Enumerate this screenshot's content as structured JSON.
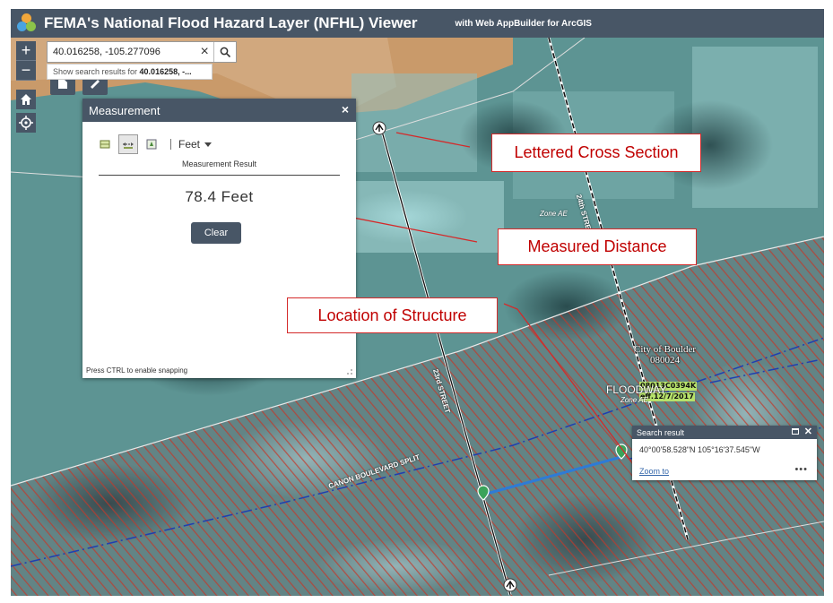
{
  "app": {
    "title": "FEMA's National Flood Hazard Layer (NFHL) Viewer",
    "subtitle": "with Web AppBuilder for ArcGIS"
  },
  "search": {
    "value": "40.016258, -105.277096",
    "suggestion_prefix": "Show search results for ",
    "suggestion_value": "40.016258, -..."
  },
  "map_controls": {
    "zoom_in": "+",
    "zoom_out": "−"
  },
  "measurement": {
    "title": "Measurement",
    "close": "×",
    "unit": "Feet",
    "result_label": "Measurement Result",
    "result_value": "78.4 Feet",
    "clear_label": "Clear",
    "snapping_hint": "Press CTRL to enable snapping"
  },
  "callouts": {
    "cross_section": "Lettered Cross Section",
    "distance": "Measured Distance",
    "structure": "Location of Structure"
  },
  "search_result": {
    "title": "Search result",
    "coordinates": "40°00'58.528\"N 105°16'37.545\"W",
    "zoom_to": "Zoom to",
    "more": "•••"
  },
  "map_labels": {
    "city_name": "City of Boulder",
    "city_code": "080024",
    "panel_id": "08013C0394K",
    "panel_date": "eff.12/7/2017",
    "flood_text": "FLOODWAY",
    "zone_text_1": "Zone AE",
    "zone_text_2": "Zone AE",
    "road_1": "CANON BOULEVARD SPLIT",
    "road_2": "23rd STREET",
    "road_3": "24th STREET"
  },
  "colors": {
    "header": "#485666",
    "callout_border": "#d42a2a",
    "callout_text": "#c00000",
    "hatch": "#c0392b",
    "measure_line": "#2e7bd6",
    "panel_label_bg": "#b7e26a"
  }
}
